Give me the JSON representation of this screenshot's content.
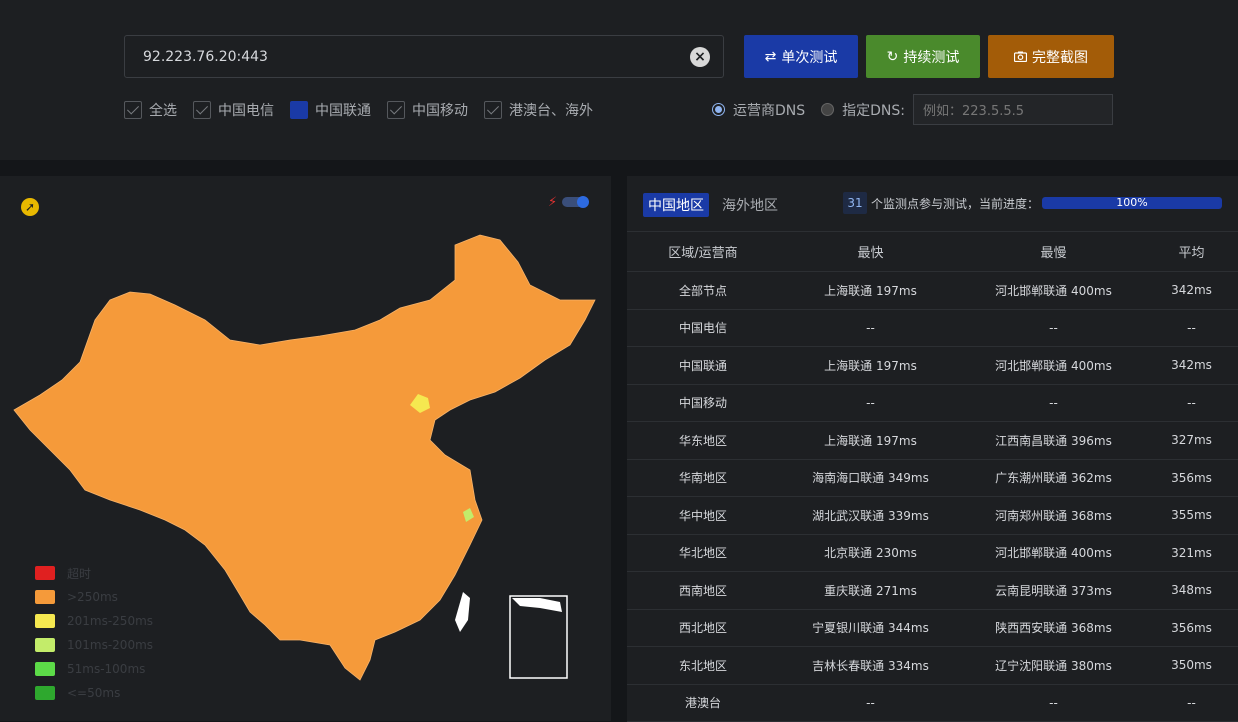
{
  "search": {
    "value": "92.223.76.20:443",
    "clear_icon": "x-circle-icon"
  },
  "buttons": {
    "single": {
      "label": "单次测试",
      "icon": "refresh-icon"
    },
    "continuous": {
      "label": "持续测试",
      "icon": "loop-icon"
    },
    "screenshot": {
      "label": "完整截图",
      "icon": "camera-icon"
    }
  },
  "filters": [
    {
      "label": "全选",
      "state": "checked"
    },
    {
      "label": "中国电信",
      "state": "checked"
    },
    {
      "label": "中国联通",
      "state": "filled"
    },
    {
      "label": "中国移动",
      "state": "checked"
    },
    {
      "label": "港澳台、海外",
      "state": "checked"
    }
  ],
  "dns": {
    "operator_label": "运营商DNS",
    "custom_label": "指定DNS:",
    "custom_placeholder": "例如：223.5.5.5"
  },
  "legend": [
    {
      "label": "超时",
      "color": "#e02020"
    },
    {
      "label": ">250ms",
      "color": "#f59a3a"
    },
    {
      "label": "201ms-250ms",
      "color": "#f5e850"
    },
    {
      "label": "101ms-200ms",
      "color": "#c3ec6a"
    },
    {
      "label": "51ms-100ms",
      "color": "#5cdb48"
    },
    {
      "label": "<=50ms",
      "color": "#2ea82e"
    }
  ],
  "tabs": [
    {
      "label": "中国地区",
      "active": true
    },
    {
      "label": "海外地区",
      "active": false
    }
  ],
  "progress": {
    "count": "31",
    "label": "个监测点参与测试，当前进度：",
    "percent_text": "100%",
    "fraction": 1.0
  },
  "table": {
    "headers": [
      "区域/运营商",
      "最快",
      "最慢",
      "平均"
    ],
    "rows": [
      [
        "全部节点",
        "上海联通 197ms",
        "河北邯郸联通 400ms",
        "342ms"
      ],
      [
        "中国电信",
        "--",
        "--",
        "--"
      ],
      [
        "中国联通",
        "上海联通 197ms",
        "河北邯郸联通 400ms",
        "342ms"
      ],
      [
        "中国移动",
        "--",
        "--",
        "--"
      ],
      [
        "华东地区",
        "上海联通 197ms",
        "江西南昌联通 396ms",
        "327ms"
      ],
      [
        "华南地区",
        "海南海口联通 349ms",
        "广东潮州联通 362ms",
        "356ms"
      ],
      [
        "华中地区",
        "湖北武汉联通 339ms",
        "河南郑州联通 368ms",
        "355ms"
      ],
      [
        "华北地区",
        "北京联通 230ms",
        "河北邯郸联通 400ms",
        "321ms"
      ],
      [
        "西南地区",
        "重庆联通 271ms",
        "云南昆明联通 373ms",
        "348ms"
      ],
      [
        "西北地区",
        "宁夏银川联通 344ms",
        "陕西西安联通 368ms",
        "356ms"
      ],
      [
        "东北地区",
        "吉林长春联通 334ms",
        "辽宁沈阳联通 380ms",
        "350ms"
      ],
      [
        "港澳台",
        "--",
        "--",
        "--"
      ]
    ]
  }
}
